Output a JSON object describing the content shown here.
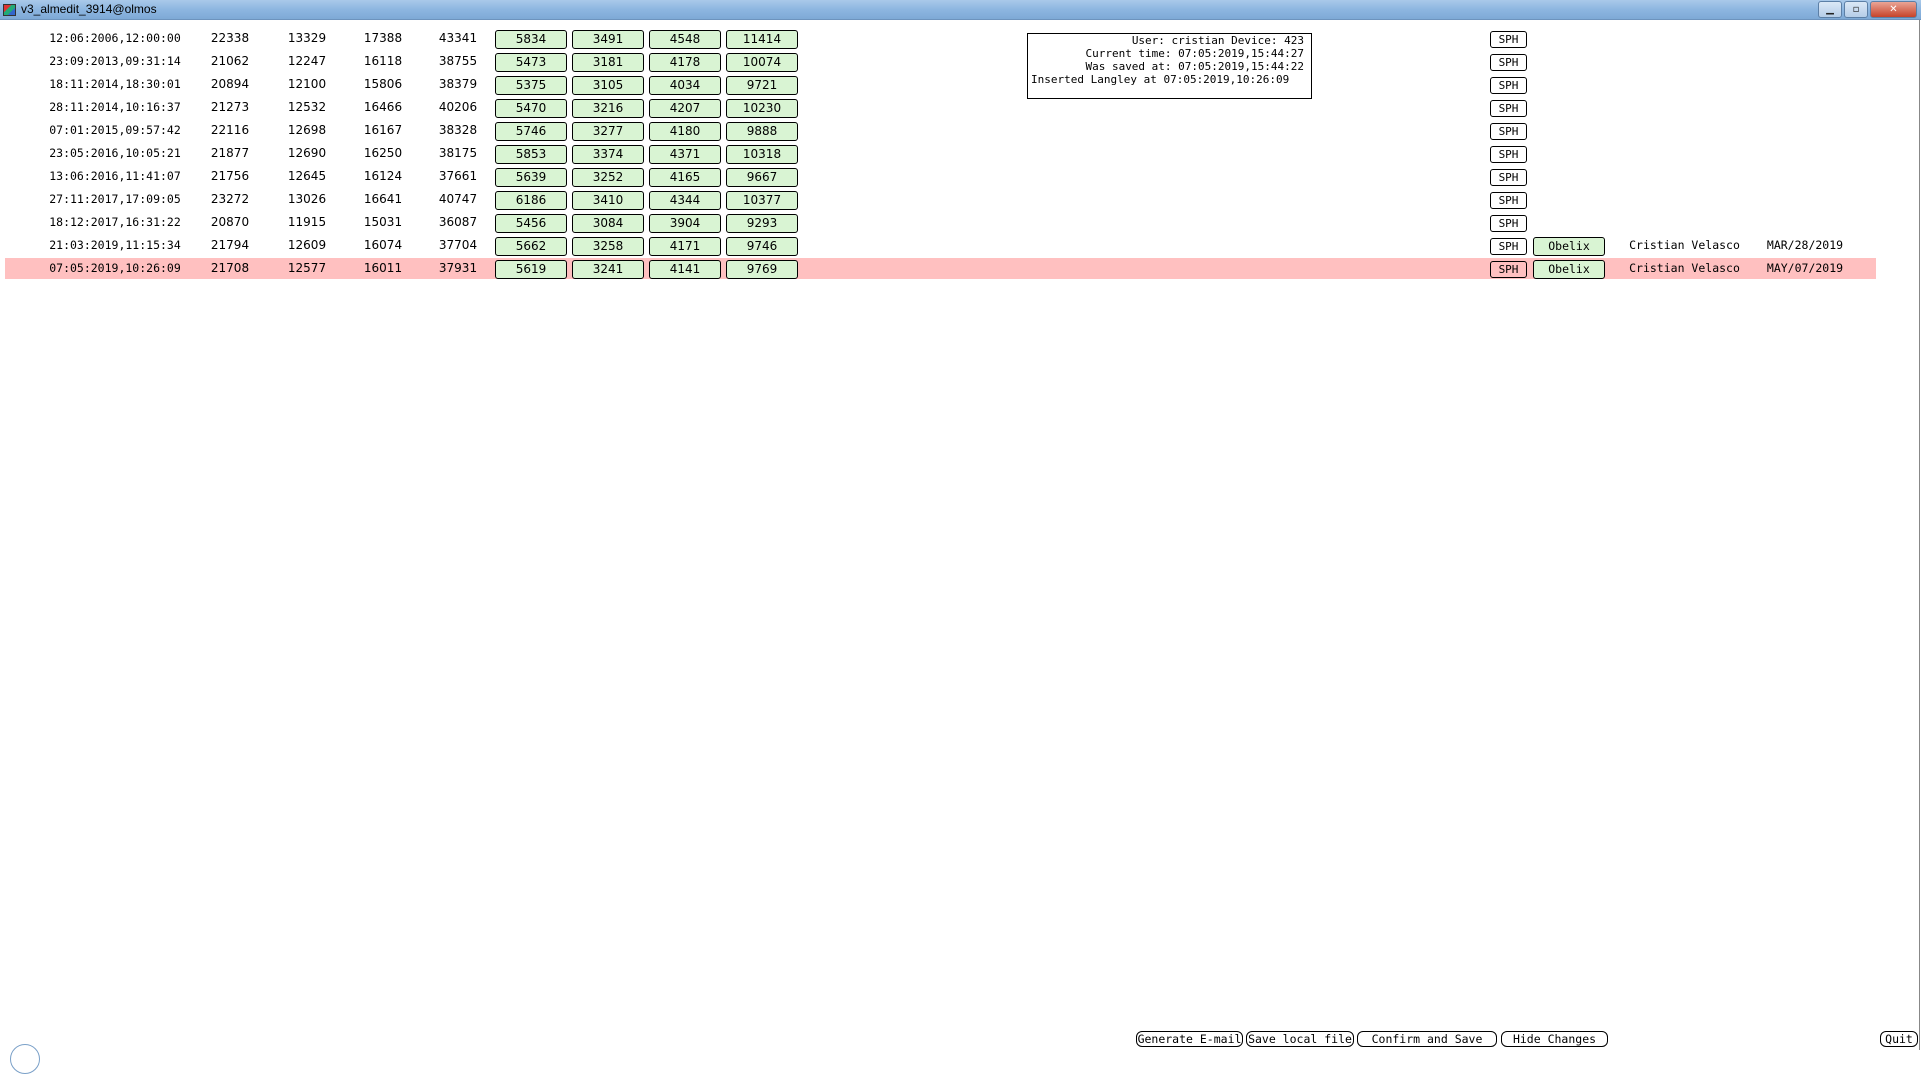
{
  "window": {
    "title": "v3_almedit_3914@olmos",
    "controls": [
      "minimize",
      "maximize",
      "close"
    ],
    "close_label": "✕"
  },
  "info": {
    "line1": "User: cristian Device: 423",
    "line2": "Current time: 07:05:2019,15:44:27",
    "line3": "Was saved at: 07:05:2019,15:44:22",
    "line4": "Inserted Langley at 07:05:2019,10:26:09"
  },
  "rows": [
    {
      "date": "12:06:2006,12:00:00",
      "v1": "22338",
      "v2": "13329",
      "v3": "17388",
      "v4": "43341",
      "b1": "5834",
      "b2": "3491",
      "b3": "4548",
      "b4": "11414",
      "sph": "SPH",
      "highlight": false
    },
    {
      "date": "23:09:2013,09:31:14",
      "v1": "21062",
      "v2": "12247",
      "v3": "16118",
      "v4": "38755",
      "b1": "5473",
      "b2": "3181",
      "b3": "4178",
      "b4": "10074",
      "sph": "SPH",
      "highlight": false
    },
    {
      "date": "18:11:2014,18:30:01",
      "v1": "20894",
      "v2": "12100",
      "v3": "15806",
      "v4": "38379",
      "b1": "5375",
      "b2": "3105",
      "b3": "4034",
      "b4": "9721",
      "sph": "SPH",
      "highlight": false
    },
    {
      "date": "28:11:2014,10:16:37",
      "v1": "21273",
      "v2": "12532",
      "v3": "16466",
      "v4": "40206",
      "b1": "5470",
      "b2": "3216",
      "b3": "4207",
      "b4": "10230",
      "sph": "SPH",
      "highlight": false
    },
    {
      "date": "07:01:2015,09:57:42",
      "v1": "22116",
      "v2": "12698",
      "v3": "16167",
      "v4": "38328",
      "b1": "5746",
      "b2": "3277",
      "b3": "4180",
      "b4": "9888",
      "sph": "SPH",
      "highlight": false
    },
    {
      "date": "23:05:2016,10:05:21",
      "v1": "21877",
      "v2": "12690",
      "v3": "16250",
      "v4": "38175",
      "b1": "5853",
      "b2": "3374",
      "b3": "4371",
      "b4": "10318",
      "sph": "SPH",
      "highlight": false
    },
    {
      "date": "13:06:2016,11:41:07",
      "v1": "21756",
      "v2": "12645",
      "v3": "16124",
      "v4": "37661",
      "b1": "5639",
      "b2": "3252",
      "b3": "4165",
      "b4": "9667",
      "sph": "SPH",
      "highlight": false
    },
    {
      "date": "27:11:2017,17:09:05",
      "v1": "23272",
      "v2": "13026",
      "v3": "16641",
      "v4": "40747",
      "b1": "6186",
      "b2": "3410",
      "b3": "4344",
      "b4": "10377",
      "sph": "SPH",
      "highlight": false
    },
    {
      "date": "18:12:2017,16:31:22",
      "v1": "20870",
      "v2": "11915",
      "v3": "15031",
      "v4": "36087",
      "b1": "5456",
      "b2": "3084",
      "b3": "3904",
      "b4": "9293",
      "sph": "SPH",
      "highlight": false
    },
    {
      "date": "21:03:2019,11:15:34",
      "v1": "21794",
      "v2": "12609",
      "v3": "16074",
      "v4": "37704",
      "b1": "5662",
      "b2": "3258",
      "b3": "4171",
      "b4": "9746",
      "sph": "SPH",
      "device": "Obelix",
      "user": "Cristian Velasco",
      "when": "MAR/28/2019",
      "highlight": false
    },
    {
      "date": "07:05:2019,10:26:09",
      "v1": "21708",
      "v2": "12577",
      "v3": "16011",
      "v4": "37931",
      "b1": "5619",
      "b2": "3241",
      "b3": "4141",
      "b4": "9769",
      "sph": "SPH",
      "device": "Obelix",
      "user": "Cristian Velasco",
      "when": "MAY/07/2019",
      "highlight": true
    }
  ],
  "colors": {
    "value_button_bg": "#d9f4d3",
    "highlight_row_bg": "#ffc0c0",
    "titlebar": "#8db6e0"
  },
  "footer": {
    "generate_email": "Generate E-mail",
    "save_local": "Save local file",
    "confirm_save": "Confirm and Save",
    "hide_changes": "Hide Changes",
    "quit": "Quit"
  }
}
